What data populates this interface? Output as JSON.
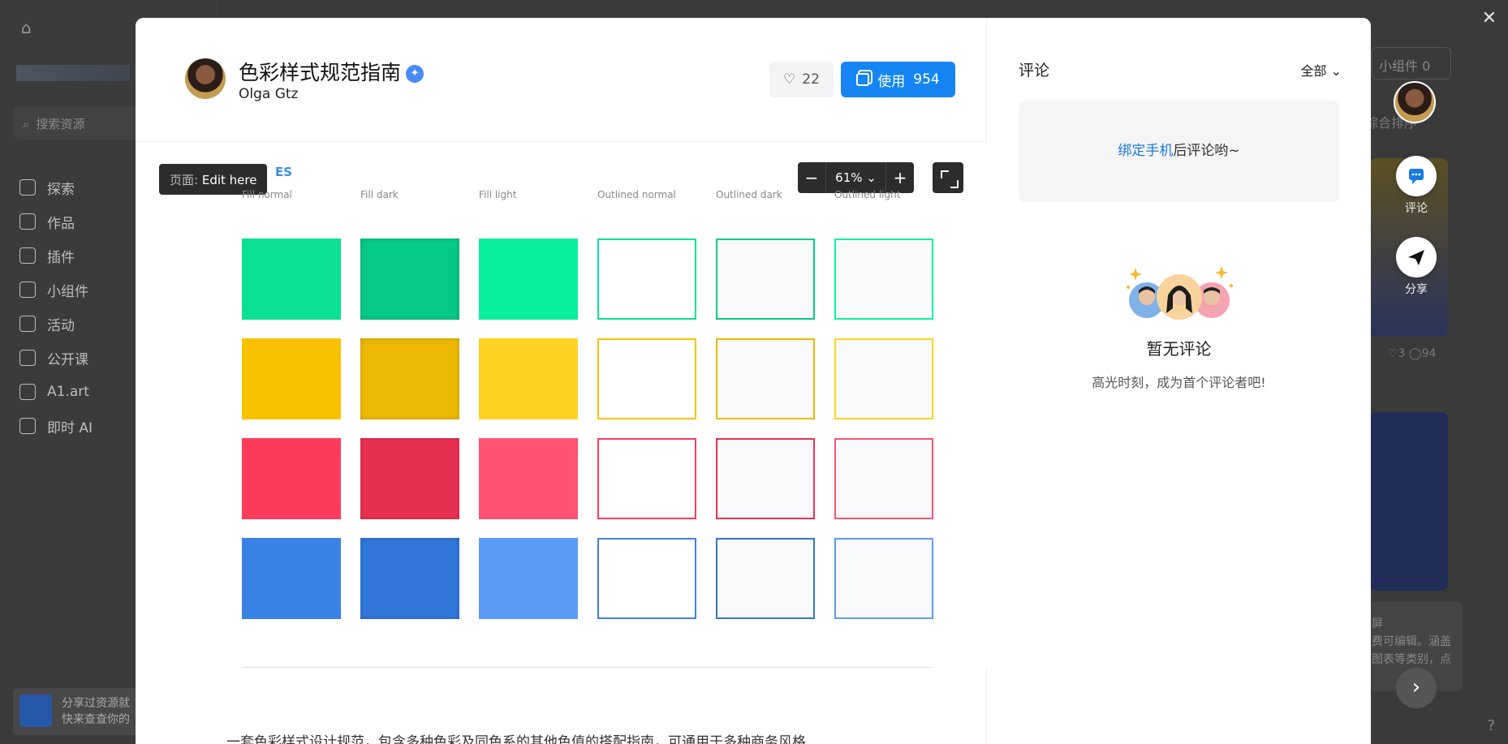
{
  "background": {
    "search_placeholder": "搜索资源",
    "nav": [
      "探索",
      "作品",
      "插件",
      "小组件",
      "活动",
      "公开课",
      "A1.art",
      "即时 AI"
    ],
    "promo_line1": "分享过资源就",
    "promo_line2": "快来查查你的",
    "top_right_label": "小组件 0",
    "sort_label": "综合排序",
    "card_meta": "♡3  ◯94",
    "card_text": "屏\n费可编辑。涵盖\n图表等类别，点"
  },
  "modal": {
    "title": "色彩样式规范指南",
    "author": "Olga Gtz",
    "likes": "22",
    "use_label": "使用",
    "use_count": "954",
    "page_badge_prefix": "页面:",
    "page_badge_name": "Edit here",
    "partial_title": "ES",
    "zoom_value": "61%",
    "columns": [
      "Fill normal",
      "Fill dark",
      "Fill light",
      "Outlined normal",
      "Outlined dark",
      "Outlined light"
    ],
    "palette": [
      {
        "normal": "#0ae192",
        "dark": "#05c985",
        "light": "#0aef9e"
      },
      {
        "normal": "#f8c200",
        "dark": "#ecb802",
        "light": "#ffd223"
      },
      {
        "normal": "#fd3b5b",
        "dark": "#ea3052",
        "light": "#ff5171"
      },
      {
        "normal": "#3b82e6",
        "dark": "#3076d8",
        "light": "#5a9bfa"
      }
    ],
    "description": "一套色彩样式设计规范，包含多种色彩及同色系的其他色值的搭配指南，可通用于多种商务风格"
  },
  "comments": {
    "title": "评论",
    "filter": "全部",
    "bind_link": "绑定手机",
    "bind_suffix": "后评论哟~",
    "empty_title": "暂无评论",
    "empty_sub": "高光时刻，成为首个评论者吧!"
  },
  "float": {
    "comment_label": "评论",
    "share_label": "分享"
  }
}
